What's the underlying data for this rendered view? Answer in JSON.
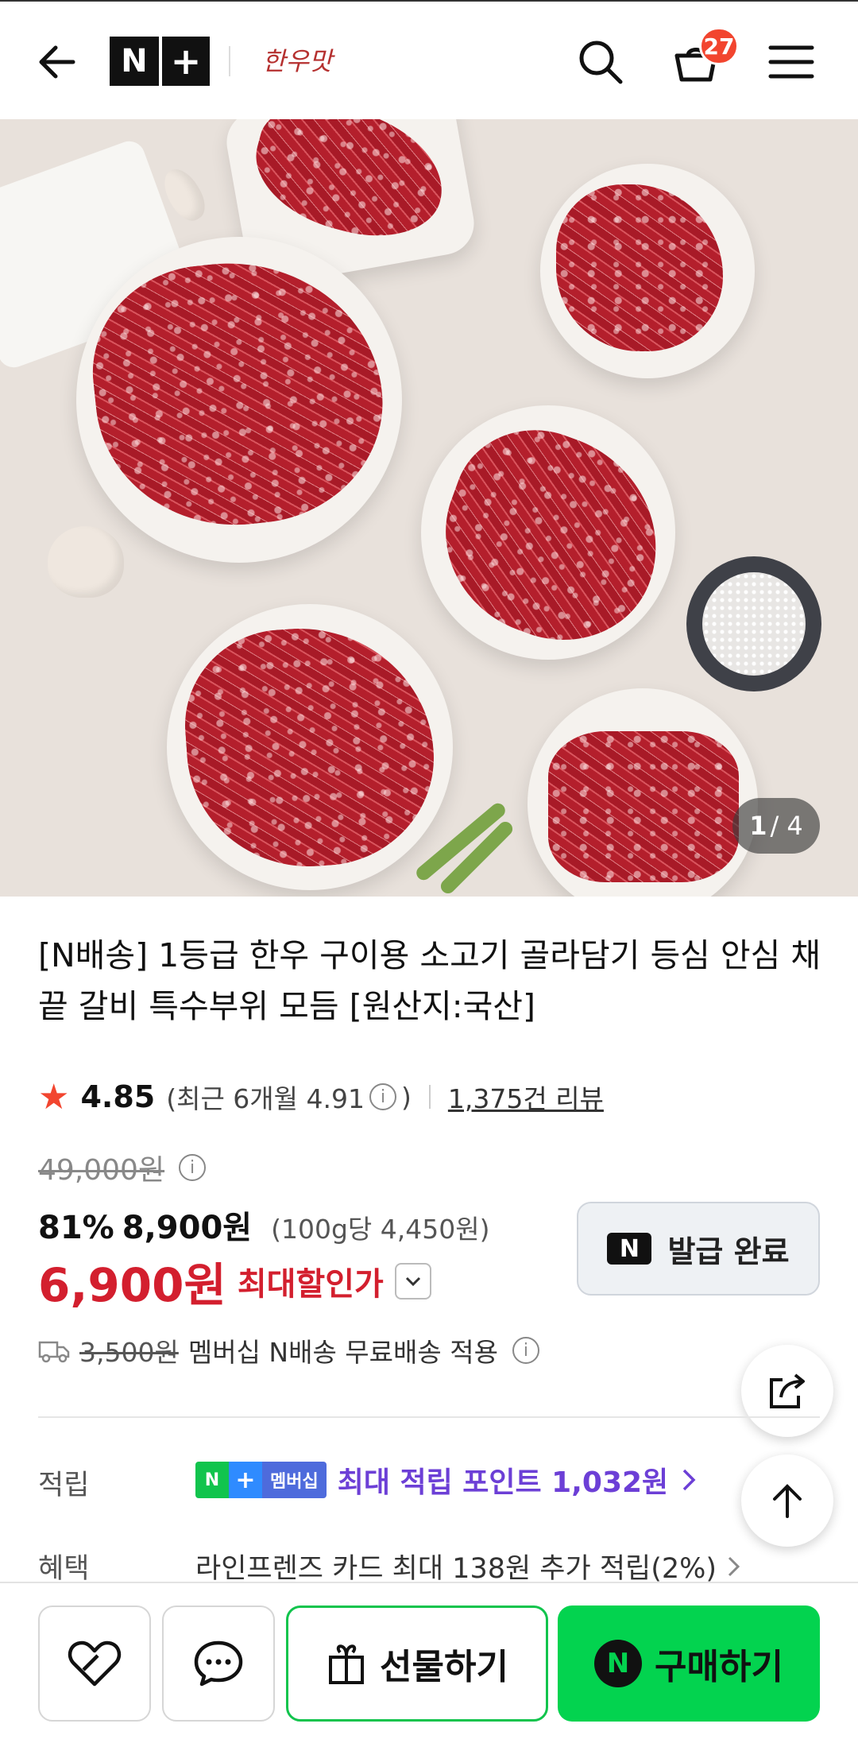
{
  "header": {
    "logo_n": "N",
    "logo_plus": "+",
    "brand": "한우맛",
    "cart_count": "27"
  },
  "hero": {
    "counter_current": "1",
    "counter_total": "/ 4"
  },
  "product": {
    "title": "[N배송] 1등급 한우 구이용 소고기 골라담기 등심 안심 채끝 갈비 특수부위 모듬 [원산지:국산]",
    "rating": {
      "score": "4.85",
      "recent_prefix": "(최근 6개월 4.91",
      "recent_suffix": ")",
      "reviews": "1,375건 리뷰"
    },
    "price": {
      "original": "49,000원",
      "discount_rate": "81%",
      "discount_price": "8,900원",
      "unit_price": "(100g당 4,450원)",
      "final": "6,900원",
      "final_label": "최대할인가"
    },
    "coupon": {
      "badge": "N",
      "label": "발급 완료"
    },
    "shipping": {
      "fee": "3,500원",
      "text": "멤버십 N배송 무료배송 적용"
    },
    "points": {
      "label": "적립",
      "badge_n": "N",
      "badge_plus": "+",
      "badge_text": "멤버십",
      "text": "최대 적립 포인트 1,032원"
    },
    "benefit": {
      "label": "혜택",
      "text": "라인프렌즈 카드 최대 138원 추가 적립(2%)"
    }
  },
  "bottom_bar": {
    "gift_label": "선물하기",
    "buy_badge": "N",
    "buy_label": "구매하기"
  },
  "colors": {
    "accent_red": "#d31f2e",
    "naver_green": "#03d34f",
    "point_purple": "#6c3fd6",
    "badge_red": "#f2452f"
  }
}
